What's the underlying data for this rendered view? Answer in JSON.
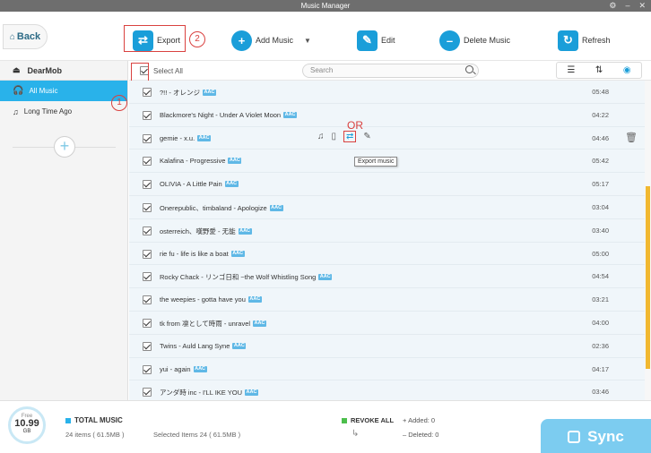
{
  "window": {
    "title": "Music Manager"
  },
  "toolbar": {
    "back_label": "Back",
    "export_label": "Export",
    "add_music_label": "Add Music",
    "edit_label": "Edit",
    "delete_label": "Delete Music",
    "refresh_label": "Refresh"
  },
  "annotations": {
    "step1": "1",
    "step2": "2",
    "or_label": "OR",
    "tooltip": "Export music"
  },
  "sidebar": {
    "device": "DearMob",
    "items": [
      {
        "label": "All Music",
        "active": true
      },
      {
        "label": "Long Time  Ago",
        "active": false
      }
    ],
    "add_symbol": "+"
  },
  "list": {
    "select_all_label": "Select All",
    "search_placeholder": "Search",
    "rows": [
      {
        "title": "?!! - オレンジ",
        "badge": "AAC",
        "duration": "05:48"
      },
      {
        "title": "Blackmore's Night - Under A Violet Moon",
        "badge": "AAC",
        "duration": "04:22"
      },
      {
        "title": "gemie - x.u.",
        "badge": "AAC",
        "duration": "04:46"
      },
      {
        "title": "Kalafina - Progressive",
        "badge": "AAC",
        "duration": "05:42"
      },
      {
        "title": "OLIVIA - A Little Pain",
        "badge": "AAC",
        "duration": "05:17"
      },
      {
        "title": "Onerepublic、timbaland - Apologize",
        "badge": "AAC",
        "duration": "03:04"
      },
      {
        "title": "osterreich、嘆野愛 - 无能",
        "badge": "AAC",
        "duration": "03:40"
      },
      {
        "title": "rie fu - life is like a boat",
        "badge": "AAC",
        "duration": "05:00"
      },
      {
        "title": "Rocky Chack - リンゴ日和 ~the Wolf Whistling Song",
        "badge": "AAC",
        "duration": "04:54"
      },
      {
        "title": "the weepies - gotta have you",
        "badge": "AAC",
        "duration": "03:21"
      },
      {
        "title": "tk from 凛として時雨 - unravel",
        "badge": "AAC",
        "duration": "04:00"
      },
      {
        "title": "Twins - Auld Lang Syne",
        "badge": "AAC",
        "duration": "02:36"
      },
      {
        "title": "yui - again",
        "badge": "AAC",
        "duration": "04:17"
      },
      {
        "title": "アンダ時 inc - I'LL IKE YOU",
        "badge": "AAC",
        "duration": "03:46"
      }
    ]
  },
  "footer": {
    "free_label": "Free",
    "free_value": "10.99",
    "free_unit": "GB",
    "total_label": "TOTAL MUSIC",
    "total_items": "24 items ( 61.5MB )",
    "selected_items": "Selected Items 24 ( 61.5MB )",
    "revoke_label": "REVOKE ALL",
    "added": "Added: 0",
    "deleted": "Deleted: 0",
    "sync_label": "Sync"
  },
  "colors": {
    "accent": "#29b2ea",
    "highlight": "#d9413f",
    "scroll": "#f1b830",
    "sync": "#7cccf0"
  }
}
